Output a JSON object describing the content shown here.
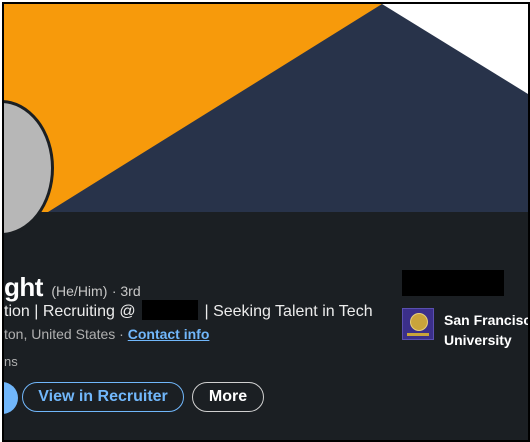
{
  "profile": {
    "name_partial": "ght",
    "pronouns": "(He/Him)",
    "degree": "· 3rd",
    "headline_start": "tion | Recruiting @",
    "headline_end": "| Seeking Talent in Tech",
    "location": "ton, United States ·",
    "contact_info": "Contact info",
    "connections_partial": "ns"
  },
  "actions": {
    "view_in_recruiter": "View in Recruiter",
    "more": "More"
  },
  "education": {
    "school_line1": "San Francisco",
    "school_line2": "University"
  },
  "colors": {
    "banner_orange": "#f79a0b",
    "banner_navy": "#28334a",
    "background": "#1b1f23",
    "link": "#71b7fb"
  }
}
